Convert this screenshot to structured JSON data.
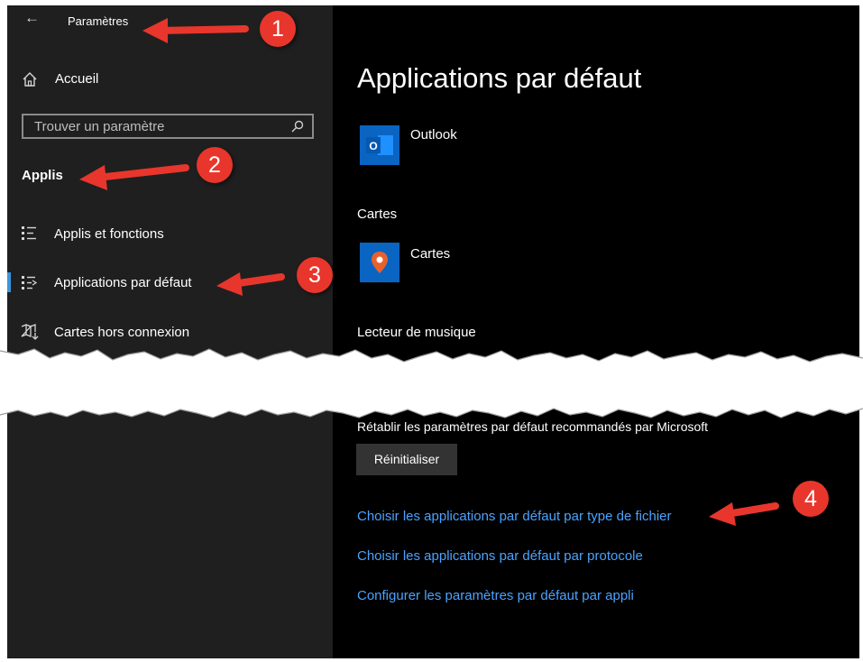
{
  "sidebar": {
    "back_icon": "back-arrow-icon",
    "title": "Paramètres",
    "home": {
      "label": "Accueil",
      "icon": "home-icon"
    },
    "search": {
      "placeholder": "Trouver un paramètre",
      "icon": "search-icon"
    },
    "section": "Applis",
    "items": [
      {
        "label": "Applis et fonctions",
        "icon": "list-icon",
        "selected": false
      },
      {
        "label": "Applications par défaut",
        "icon": "default-apps-icon",
        "selected": true
      },
      {
        "label": "Cartes hors connexion",
        "icon": "map-download-icon",
        "selected": false
      }
    ]
  },
  "main": {
    "title": "Applications par défaut",
    "email_app": {
      "name": "Outlook",
      "icon": "outlook-icon",
      "tile_color": "#0a64c1"
    },
    "maps": {
      "heading": "Cartes",
      "app": "Cartes",
      "icon": "maps-pin-icon",
      "tile_color": "#0a64c1"
    },
    "music": {
      "heading": "Lecteur de musique"
    },
    "reset": {
      "text": "Rétablir les paramètres par défaut recommandés par Microsoft",
      "button": "Réinitialiser"
    },
    "links": [
      "Choisir les applications par défaut par type de fichier",
      "Choisir les applications par défaut par protocole",
      "Configurer les paramètres par défaut par appli"
    ]
  },
  "annotations": {
    "badges": [
      "1",
      "2",
      "3",
      "4"
    ],
    "color": "#e8362c"
  },
  "colors": {
    "sidebar_bg": "#1f1f1f",
    "main_bg": "#000000",
    "accent": "#3a96dd",
    "link": "#4aa3ff"
  }
}
